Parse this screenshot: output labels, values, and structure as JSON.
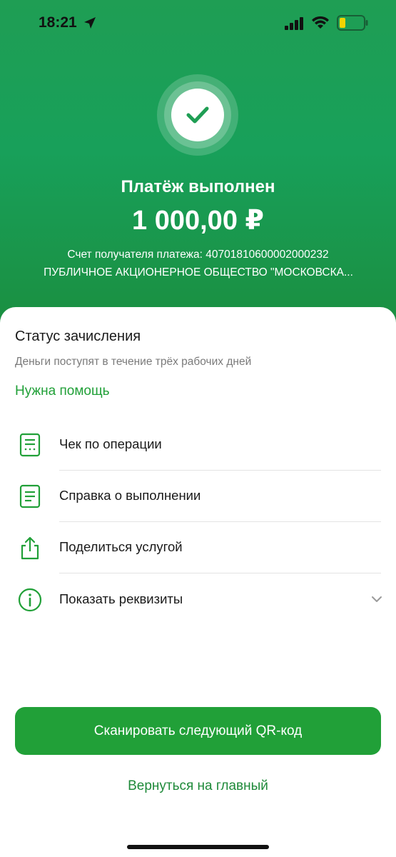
{
  "status_bar": {
    "time": "18:21",
    "icons": [
      "location-arrow-icon",
      "cellular-signal-icon",
      "wifi-icon",
      "battery-icon"
    ]
  },
  "header": {
    "title": "Платёж выполнен",
    "amount": "1 000,00 ₽",
    "account_line": "Счет получателя платежа: 40701810600002000232",
    "recipient": "ПУБЛИЧНОЕ АКЦИОНЕРНОЕ ОБЩЕСТВО \"МОСКОВСКА..."
  },
  "status_section": {
    "title": "Статус зачисления",
    "description": "Деньги поступят в течение трёх рабочих дней",
    "help_link": "Нужна помощь"
  },
  "actions": [
    {
      "label": "Чек по операции",
      "icon": "receipt-icon"
    },
    {
      "label": "Справка о выполнении",
      "icon": "document-icon"
    },
    {
      "label": "Поделиться услугой",
      "icon": "share-icon"
    },
    {
      "label": "Показать реквизиты",
      "icon": "info-icon"
    }
  ],
  "footer": {
    "primary_button": "Сканировать следующий QR-код",
    "secondary_link": "Вернуться на главный"
  },
  "colors": {
    "brand_green": "#21a038",
    "header_gradient_top": "#1f9e54",
    "header_gradient_bottom": "#1b8e3f"
  }
}
